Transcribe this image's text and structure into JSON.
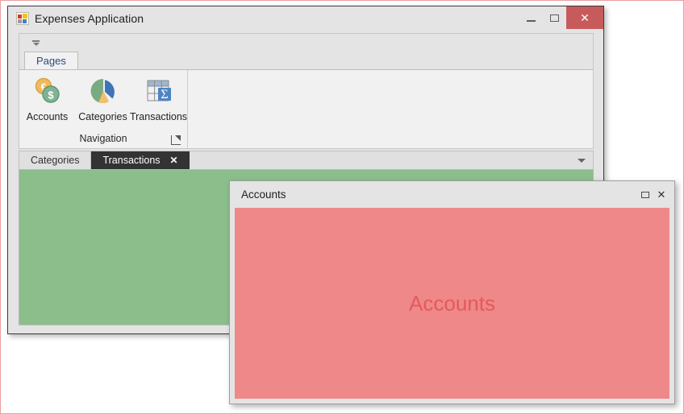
{
  "main_window": {
    "title": "Expenses Application",
    "app_icon": "application-squares-icon",
    "controls": {
      "minimize": "minimize-icon",
      "maximize": "maximize-icon",
      "close": "✕"
    }
  },
  "quick_access": {
    "customize_label": "customize-quick-access-toolbar-icon"
  },
  "ribbon": {
    "tabs": [
      {
        "label": "Pages",
        "active": true
      }
    ],
    "group": {
      "title": "Navigation",
      "dialog_launcher": "dialog-box-launcher-icon",
      "items": [
        {
          "label": "Accounts",
          "icon": "coins-euro-dollar-icon"
        },
        {
          "label": "Categories",
          "icon": "pie-chart-icon"
        },
        {
          "label": "Transactions",
          "icon": "table-sigma-icon"
        }
      ]
    }
  },
  "document_tabs": {
    "tabs": [
      {
        "label": "Categories",
        "active": false,
        "closable": false
      },
      {
        "label": "Transactions",
        "active": true,
        "closable": true,
        "close_glyph": "✕"
      }
    ],
    "overflow": "tab-list-dropdown-icon"
  },
  "document_surface": {
    "caption": "",
    "color": "#8CBE8C"
  },
  "accounts_window": {
    "title": "Accounts",
    "caption": "Accounts",
    "body_color": "#EF8888",
    "caption_color": "#E45A5A",
    "controls": {
      "maximize": "maximize-icon",
      "close": "✕"
    }
  },
  "colors": {
    "window_chrome": "#E4E4E4",
    "close_button": "#C75B5B",
    "ribbon_tab_text": "#2A4B7C",
    "active_doc_tab_bg": "#333333",
    "green_panel": "#8CBE8C",
    "red_panel": "#EF8888",
    "outer_border": "#E9A0A0"
  }
}
